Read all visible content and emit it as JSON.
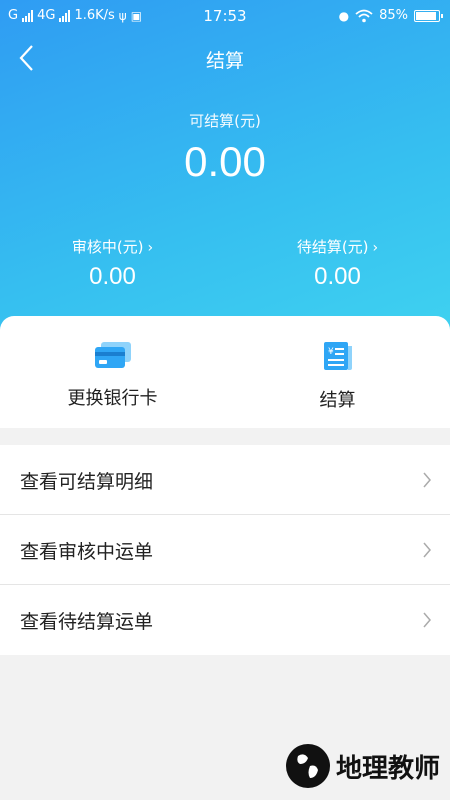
{
  "status_bar": {
    "carrier1": "G",
    "carrier2": "4G",
    "speed": "1.6K/s",
    "time": "17:53",
    "battery": "85%"
  },
  "header": {
    "title": "结算"
  },
  "summary": {
    "available_label": "可结算(元)",
    "available_value": "0.00",
    "reviewing_label": "审核中(元)",
    "reviewing_value": "0.00",
    "pending_label": "待结算(元)",
    "pending_value": "0.00"
  },
  "actions": [
    {
      "label": "更换银行卡",
      "icon": "bank-card-icon"
    },
    {
      "label": "结算",
      "icon": "invoice-icon"
    }
  ],
  "menu": [
    {
      "label": "查看可结算明细"
    },
    {
      "label": "查看审核中运单"
    },
    {
      "label": "查看待结算运单"
    }
  ],
  "watermark": {
    "text": "地理教师"
  },
  "colors": {
    "gradient_start": "#2f9cf3",
    "gradient_end": "#3fd2f0",
    "icon_blue": "#2fa6f5"
  }
}
